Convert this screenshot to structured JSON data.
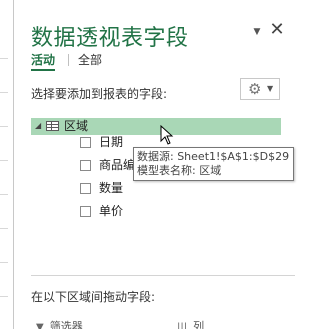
{
  "pane": {
    "title": "数据透视表字段",
    "dropdown_icon": "caret-down-icon",
    "close_icon": "close-icon"
  },
  "tabs": [
    {
      "label": "活动",
      "active": true
    },
    {
      "label": "全部",
      "active": false
    }
  ],
  "prompt": "选择要添加到报表的字段:",
  "tools": {
    "icon": "gear-icon",
    "caret": "caret-down-icon"
  },
  "table": {
    "name": "区域",
    "expanded": true,
    "highlighted": true
  },
  "fields": [
    {
      "label": "日期",
      "checked": false
    },
    {
      "label": "商品编号",
      "checked": false
    },
    {
      "label": "数量",
      "checked": false
    },
    {
      "label": "单价",
      "checked": false
    }
  ],
  "tooltip": {
    "line1": "数据源: Sheet1!$A$1:$D$29",
    "line2": "模型表名称: 区域"
  },
  "areas_prompt": "在以下区域间拖动字段:",
  "areas": [
    {
      "label": "筛选器",
      "icon": "filter-icon"
    },
    {
      "label": "列",
      "icon": "columns-icon"
    }
  ],
  "colors": {
    "accent": "#217346",
    "highlight": "#a9d7b6"
  }
}
